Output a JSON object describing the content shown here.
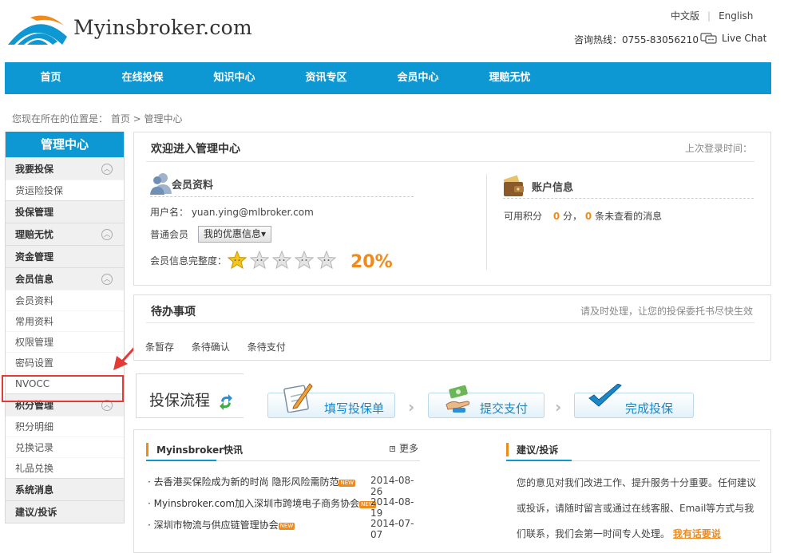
{
  "header": {
    "logo_text": "Myinsbroker.com",
    "lang_cn": "中文版",
    "lang_en": "English",
    "hotline": "咨询热线：0755-83056210",
    "live_chat": "Live Chat"
  },
  "nav": [
    "首页",
    "在线投保",
    "知识中心",
    "资讯专区",
    "会员中心",
    "理赔无忧"
  ],
  "breadcrumb": "您现在所在的位置是： 首页 > 管理中心",
  "sidebar": {
    "title": "管理中心",
    "groups": [
      {
        "label": "我要投保",
        "collapsible": true,
        "items": [
          "货运险投保"
        ]
      },
      {
        "label": "投保管理",
        "collapsible": false,
        "items": []
      },
      {
        "label": "理赔无忧",
        "collapsible": true,
        "items": []
      },
      {
        "label": "资金管理",
        "collapsible": false,
        "items": []
      },
      {
        "label": "会员信息",
        "collapsible": true,
        "items": [
          "会员资料",
          "常用资料",
          "权限管理",
          "密码设置",
          "NVOCC"
        ]
      },
      {
        "label": "积分管理",
        "collapsible": true,
        "items": [
          "积分明细",
          "兑换记录",
          "礼品兑换"
        ]
      },
      {
        "label": "系统消息",
        "collapsible": false,
        "items": []
      },
      {
        "label": "建议/投诉",
        "collapsible": false,
        "items": []
      }
    ],
    "toggle_glyph": "︿"
  },
  "welcome": {
    "title": "欢迎进入管理中心",
    "last_login": "上次登录时间：",
    "member_section": "会员资料",
    "username": "用户名： yuan.ying@mlbroker.com",
    "member_type": "普通会员",
    "coupon": "我的优惠信息▾",
    "completeness_label": "会员信息完整度：",
    "completeness_pct": "20%",
    "stars_total": 5,
    "stars_filled": 1,
    "account_section": "账户信息",
    "points_label": "可用积分",
    "points": "0",
    "points_unit": "分，",
    "unread": "0",
    "unread_label": "条未查看的消息"
  },
  "todo": {
    "title": "待办事项",
    "hint": "请及时处理，让您的投保委托书尽快生效",
    "items": [
      "条暂存",
      "条待确认",
      "条待支付"
    ]
  },
  "flow": {
    "title": "投保流程",
    "steps": [
      "填写投保单",
      "提交支付",
      "完成投保"
    ]
  },
  "news": {
    "title": "Myinsbroker快讯",
    "more": "更多",
    "badge": "NEW",
    "items": [
      {
        "text": "去香港买保险成为新的时尚 隐形风险需防范",
        "date": "2014-08-26"
      },
      {
        "text": "Myinsbroker.com加入深圳市跨境电子商务协会",
        "date": "2014-08-19"
      },
      {
        "text": "深圳市物流与供应链管理协会",
        "date": "2014-07-07"
      }
    ]
  },
  "suggest": {
    "title": "建议/投诉",
    "text": "您的意见对我们改进工作、提升服务十分重要。任何建议或投诉，请随时留言或通过在线客服、Email等方式与我们联系，我们会第一时间专人处理。",
    "link": "我有话要说"
  },
  "colors": {
    "brand_blue": "#0d98d3",
    "accent_orange": "#ef8a1c",
    "highlight_red": "#e53935"
  }
}
